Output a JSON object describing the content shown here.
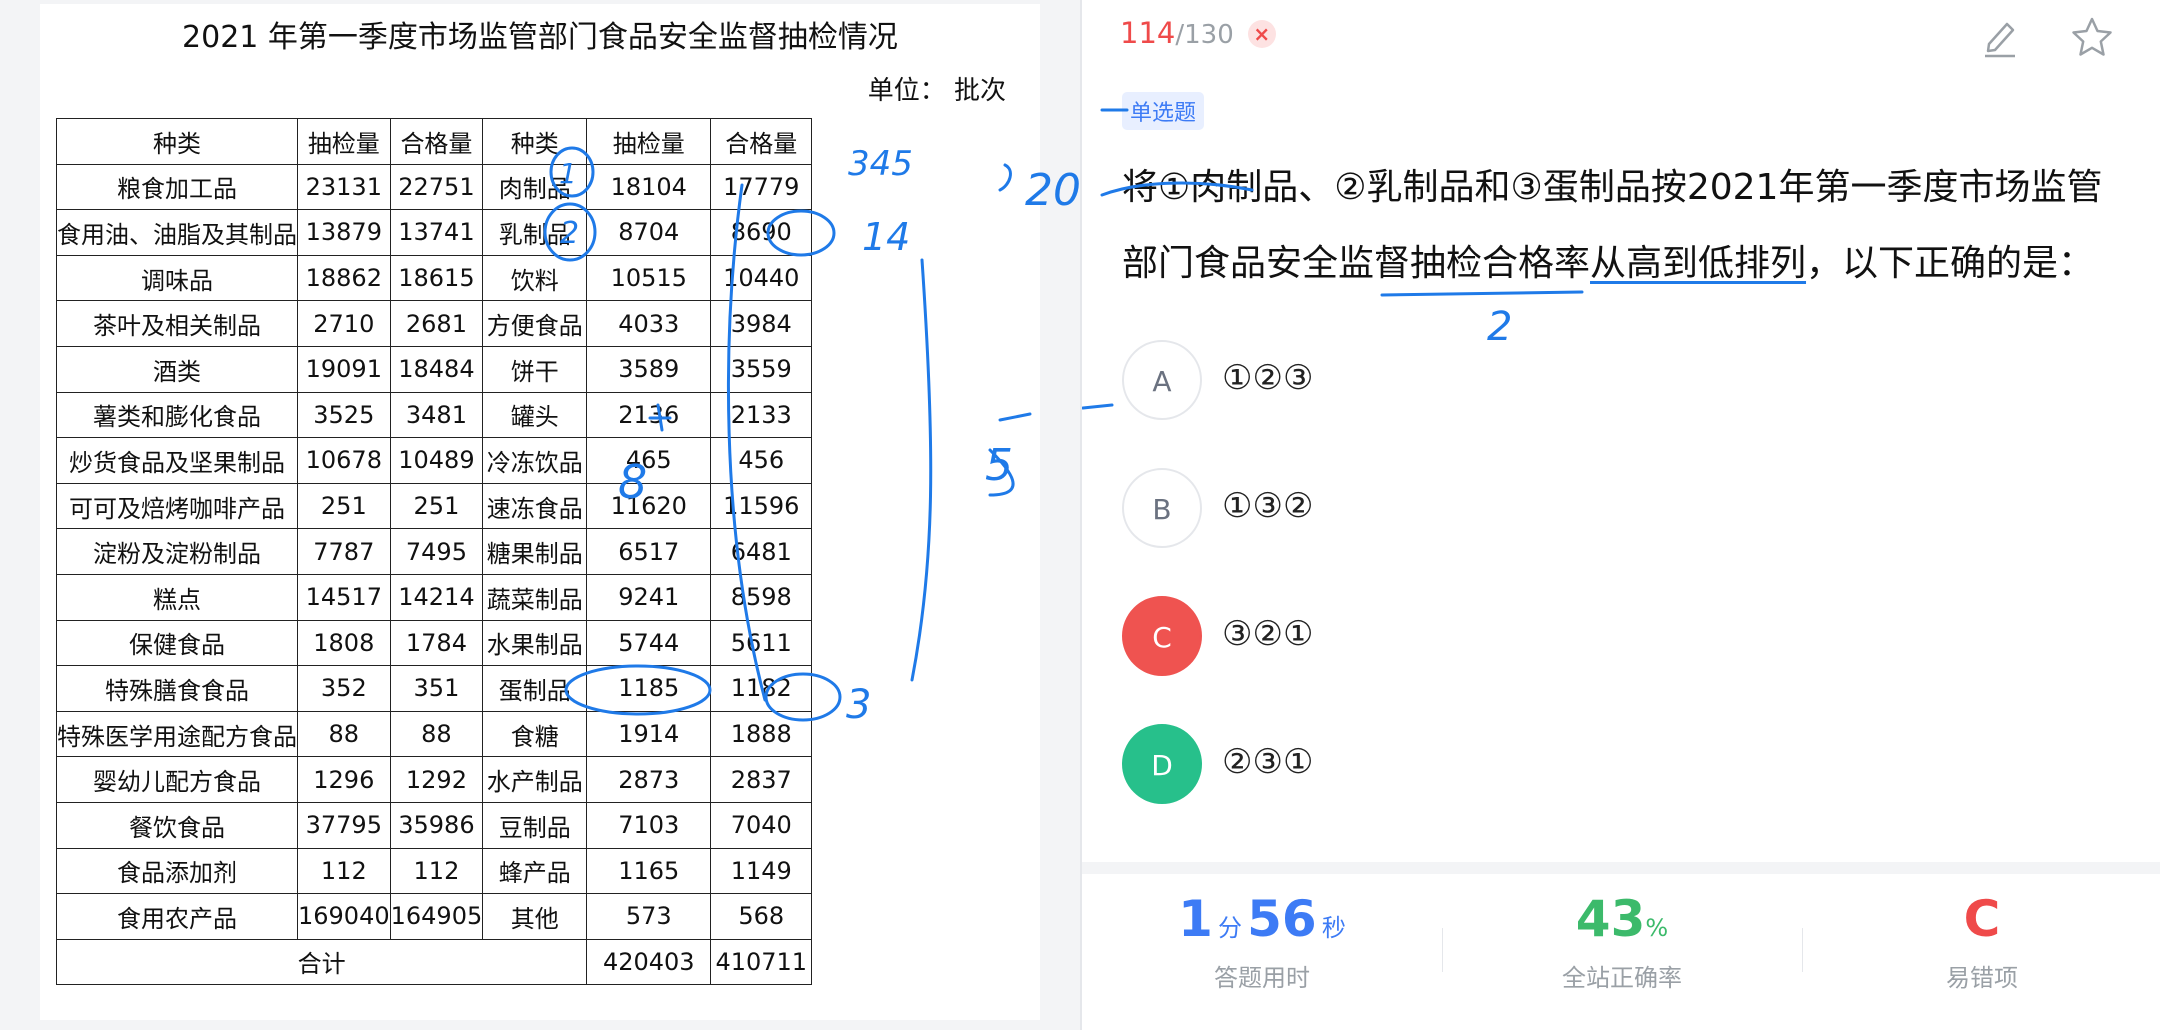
{
  "table": {
    "title": "2021 年第一季度市场监管部门食品安全监督抽检情况",
    "unit": "单位：  批次",
    "headers": [
      "种类",
      "抽检量",
      "合格量",
      "种类",
      "抽检量",
      "合格量"
    ],
    "rows": [
      [
        "粮食加工品",
        "23131",
        "22751",
        "肉制品",
        "18104",
        "17779"
      ],
      [
        "食用油、油脂及其制品",
        "13879",
        "13741",
        "乳制品",
        "8704",
        "8690"
      ],
      [
        "调味品",
        "18862",
        "18615",
        "饮料",
        "10515",
        "10440"
      ],
      [
        "茶叶及相关制品",
        "2710",
        "2681",
        "方便食品",
        "4033",
        "3984"
      ],
      [
        "酒类",
        "19091",
        "18484",
        "饼干",
        "3589",
        "3559"
      ],
      [
        "薯类和膨化食品",
        "3525",
        "3481",
        "罐头",
        "2136",
        "2133"
      ],
      [
        "炒货食品及坚果制品",
        "10678",
        "10489",
        "冷冻饮品",
        "465",
        "456"
      ],
      [
        "可可及焙烤咖啡产品",
        "251",
        "251",
        "速冻食品",
        "11620",
        "11596"
      ],
      [
        "淀粉及淀粉制品",
        "7787",
        "7495",
        "糖果制品",
        "6517",
        "6481"
      ],
      [
        "糕点",
        "14517",
        "14214",
        "蔬菜制品",
        "9241",
        "8598"
      ],
      [
        "保健食品",
        "1808",
        "1784",
        "水果制品",
        "5744",
        "5611"
      ],
      [
        "特殊膳食食品",
        "352",
        "351",
        "蛋制品",
        "1185",
        "1182"
      ],
      [
        "特殊医学用途配方食品",
        "88",
        "88",
        "食糖",
        "1914",
        "1888"
      ],
      [
        "婴幼儿配方食品",
        "1296",
        "1292",
        "水产制品",
        "2873",
        "2837"
      ],
      [
        "餐饮食品",
        "37795",
        "35986",
        "豆制品",
        "7103",
        "7040"
      ],
      [
        "食品添加剂",
        "112",
        "112",
        "蜂产品",
        "1165",
        "1149"
      ],
      [
        "食用农产品",
        "169040",
        "164905",
        "其他",
        "573",
        "568"
      ]
    ],
    "total_label": "合计",
    "total_sample": "420403",
    "total_pass": "410711"
  },
  "question": {
    "current": "114",
    "total": "/130",
    "wrong_mark": "×",
    "type_tag": "单选题",
    "stem_part1": "将①肉制品、②乳制品和③蛋制品按2021年第一季度市场监管部门食品安全监督抽检合格率",
    "stem_underlined": "从高到低排列",
    "stem_part2": "，以下正确的是：",
    "options": [
      {
        "letter": "A",
        "text": "①②③",
        "state": "normal"
      },
      {
        "letter": "B",
        "text": "①③②",
        "state": "normal"
      },
      {
        "letter": "C",
        "text": "③②①",
        "state": "wrong"
      },
      {
        "letter": "D",
        "text": "②③①",
        "state": "correct"
      }
    ]
  },
  "stats": {
    "time_min": "1",
    "time_min_unit": "分",
    "time_sec": "56",
    "time_sec_unit": "秒",
    "time_label": "答题用时",
    "accuracy": "43",
    "accuracy_unit": "%",
    "accuracy_label": "全站正确率",
    "common_wrong": "C",
    "common_wrong_label": "易错项"
  },
  "handwriting": {
    "numerals": [
      "1",
      "2",
      "3",
      "345",
      "20",
      "14",
      "8",
      "5",
      "-",
      "3",
      "2",
      "+"
    ]
  },
  "colors": {
    "accent_red": "#ef4a4a",
    "correct_green": "#27c08b",
    "wrong_red": "#ef5350",
    "time_blue": "#3d7bf5",
    "accuracy_green": "#3cba6b",
    "ink_blue": "#1f7ae8"
  },
  "icons": [
    "edit-icon",
    "star-icon",
    "wrong-x-icon"
  ]
}
